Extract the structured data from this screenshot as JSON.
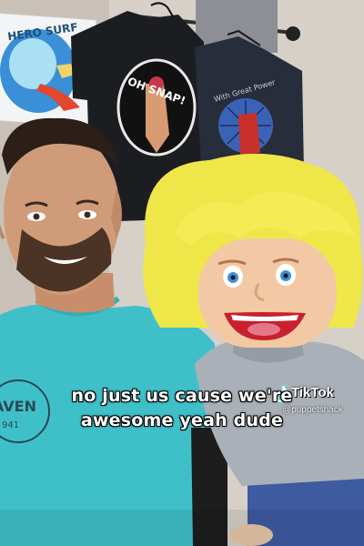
{
  "caption": {
    "line1": "no just us cause we're",
    "line2": "awesome yeah dude"
  },
  "watermark": {
    "logo_text": "TikTok",
    "handle": "@puppetshack"
  },
  "shirt_prints": {
    "shirt_1_text": "OH SNAP!",
    "shirt_2_text": "With Great Power",
    "left_poster_text": "HERO SURF"
  },
  "colors": {
    "wall": "#d9d4cf",
    "tshirt_teal": "#3fc0c9",
    "puppet_hair": "#f2e94a",
    "puppet_skin": "#f2c9a4",
    "puppet_sweater": "#a9adb3",
    "dark_shirt": "#1e2024",
    "navy_shirt": "#2b3140"
  }
}
